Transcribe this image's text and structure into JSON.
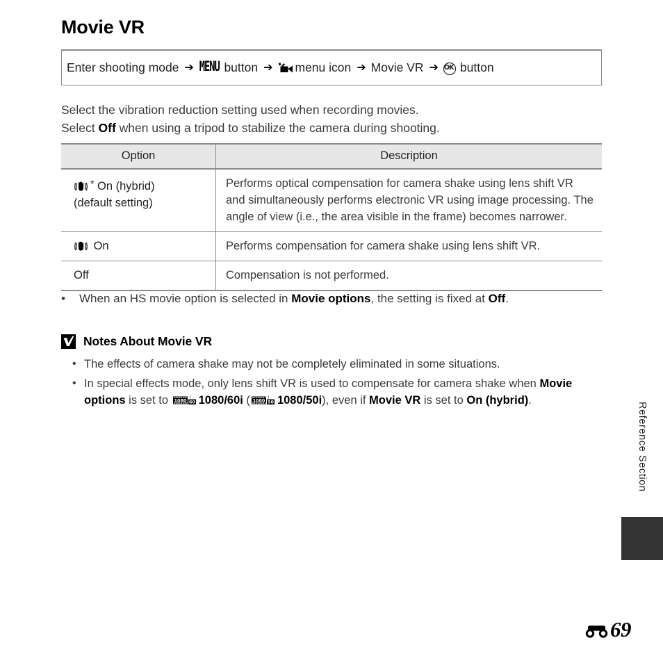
{
  "page": {
    "title": "Movie VR",
    "side_label": "Reference Section",
    "folio_prefix_icon": "reference-section-icon",
    "folio": "69"
  },
  "nav_path": {
    "segments": [
      {
        "type": "text",
        "value": "Enter shooting mode"
      },
      {
        "type": "arrow",
        "value": "➔"
      },
      {
        "type": "icon-menu",
        "value": "MENU"
      },
      {
        "type": "text",
        "value": "button"
      },
      {
        "type": "arrow",
        "value": "➔"
      },
      {
        "type": "icon-movie",
        "value": "movie-menu-icon"
      },
      {
        "type": "text",
        "value": "menu icon"
      },
      {
        "type": "arrow",
        "value": "➔"
      },
      {
        "type": "text",
        "value": "Movie VR"
      },
      {
        "type": "arrow",
        "value": "➔"
      },
      {
        "type": "icon-ok",
        "value": "OK"
      },
      {
        "type": "text",
        "value": "button"
      }
    ]
  },
  "intro": {
    "line1": "Select the vibration reduction setting used when recording movies.",
    "line2_pre": "Select ",
    "line2_bold": "Off",
    "line2_post": " when using a tripod to stabilize the camera during shooting."
  },
  "table": {
    "headers": {
      "option": "Option",
      "description": "Description"
    },
    "rows": [
      {
        "icon": "vr-hand-icon",
        "star": "*",
        "option_line1": " On (hybrid)",
        "option_line2": "(default setting)",
        "description": "Performs optical compensation for camera shake using lens shift VR and simultaneously performs electronic VR using image processing. The angle of view (i.e., the area visible in the frame) becomes narrower."
      },
      {
        "icon": "vr-hand-icon",
        "star": "",
        "option_line1": " On",
        "option_line2": "",
        "description": "Performs compensation for camera shake using lens shift VR."
      },
      {
        "icon": "",
        "star": "",
        "option_line1": "Off",
        "option_line2": "",
        "description": "Compensation is not performed."
      }
    ]
  },
  "bullet_hs": {
    "marker": "•",
    "pre": "When an HS movie option is selected in ",
    "bold1": "Movie options",
    "mid": ", the setting is fixed at ",
    "bold2": "Off",
    "post": "."
  },
  "notes": {
    "icon": "warning-check-icon",
    "title": "Notes About Movie VR",
    "items": [
      {
        "marker": "•",
        "text": "The effects of camera shake may not be completely eliminated in some situations."
      },
      {
        "marker": "•",
        "seg_pre": "In special effects mode, only lens shift VR is used to compensate for camera shake when ",
        "seg_bold1": "Movie options",
        "seg_mid1": " is set to ",
        "icon1": "1080-60i-icon",
        "icon1_res": "1080",
        "icon1_rate": "60",
        "icon1_sup": "i",
        "seg_bold2": "1080/60i",
        "seg_mid2": " (",
        "icon2": "1080-50i-icon",
        "icon2_res": "1080",
        "icon2_rate": "50",
        "icon2_sup": "i",
        "seg_bold3": "1080/50i",
        "seg_mid3": "), even if ",
        "seg_bold4": "Movie VR",
        "seg_mid4": " is set to ",
        "seg_bold5": "On (hybrid)",
        "seg_post": "."
      }
    ]
  },
  "colors": {
    "rule": "#8b8b8b",
    "header_fill": "#e7e7e7",
    "body_text": "#3a3a3a",
    "tab": "#333333"
  }
}
